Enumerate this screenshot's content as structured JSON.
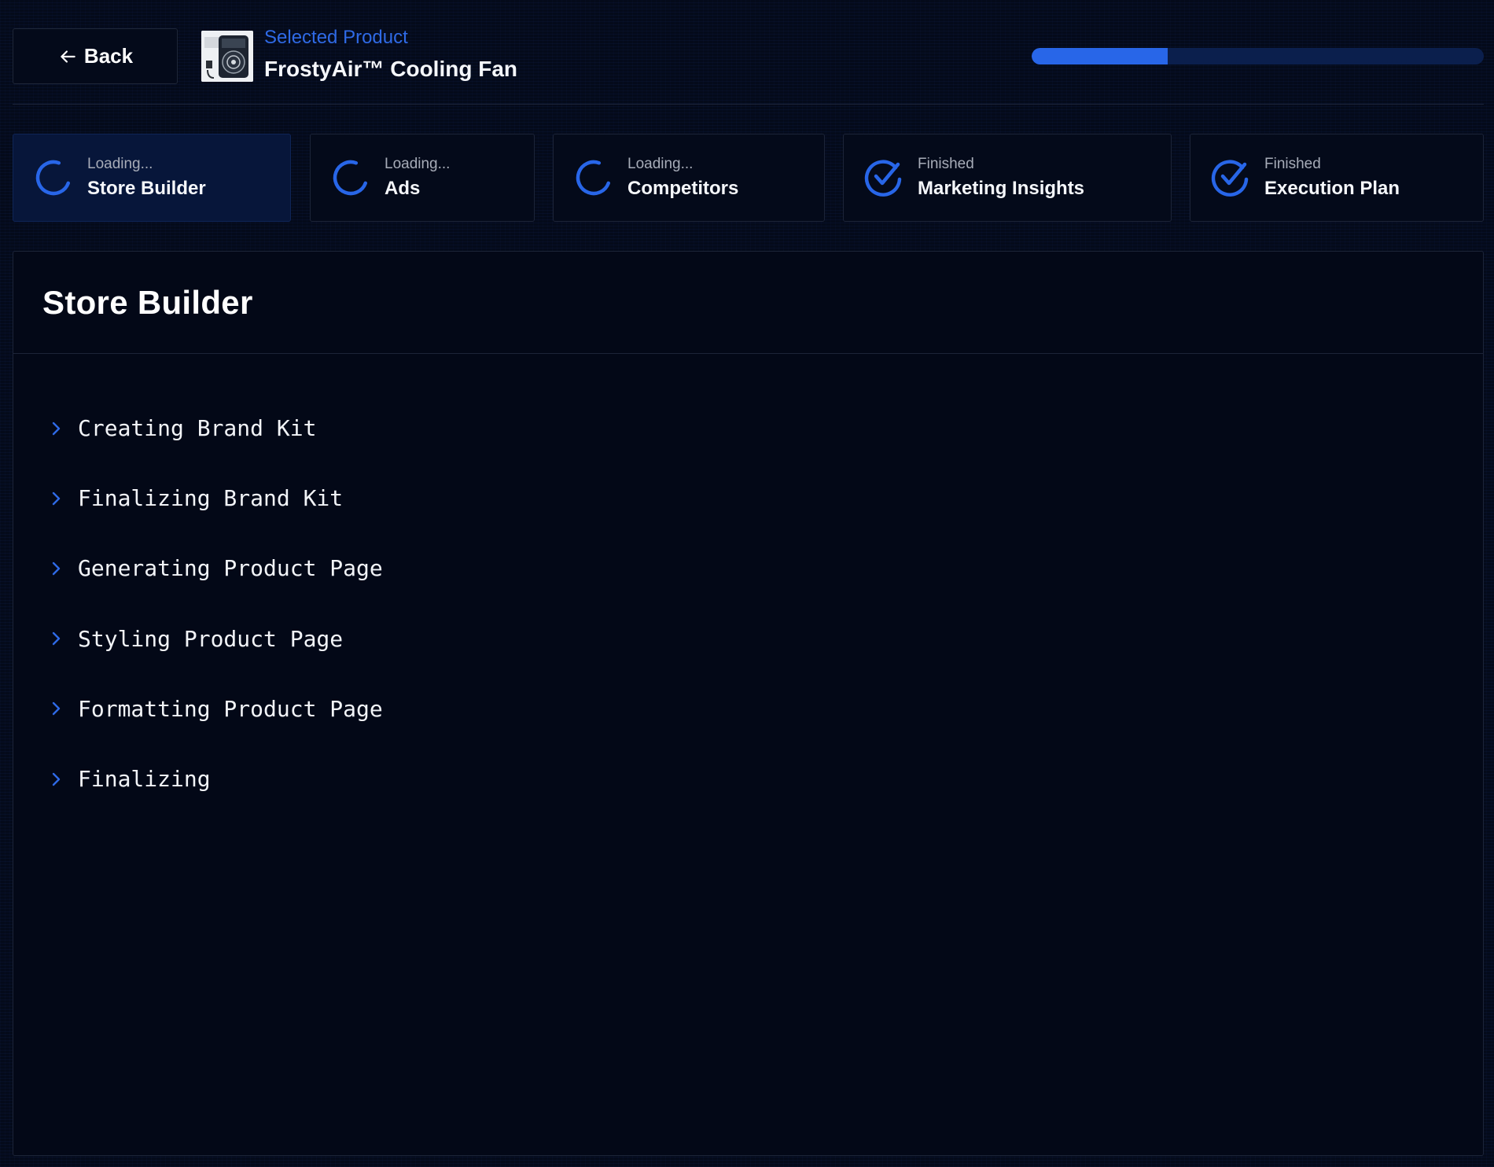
{
  "header": {
    "back_label": "Back",
    "selected_label": "Selected Product",
    "product_title": "FrostyAir™ Cooling Fan",
    "product_thumbnail": "portable-cooling-fan-image",
    "progress_percent": 30
  },
  "colors": {
    "accent": "#2866e8",
    "accent_text": "#2f6ae6",
    "progress_track": "#0b1f4d",
    "background": "#040a1a",
    "active_card": "#07163a",
    "border": "#1c2438"
  },
  "cards": [
    {
      "status": "Loading...",
      "name": "Store Builder",
      "state": "loading",
      "icon": "spinner-icon",
      "active": true
    },
    {
      "status": "Loading...",
      "name": "Ads",
      "state": "loading",
      "icon": "spinner-icon",
      "active": false
    },
    {
      "status": "Loading...",
      "name": "Competitors",
      "state": "loading",
      "icon": "spinner-icon",
      "active": false
    },
    {
      "status": "Finished",
      "name": "Marketing Insights",
      "state": "finished",
      "icon": "check-circle-icon",
      "active": false
    },
    {
      "status": "Finished",
      "name": "Execution Plan",
      "state": "finished",
      "icon": "check-circle-icon",
      "active": false
    }
  ],
  "panel": {
    "title": "Store Builder",
    "steps": [
      {
        "label": "Creating Brand Kit",
        "icon": "chevron-right-icon"
      },
      {
        "label": "Finalizing Brand Kit",
        "icon": "chevron-right-icon"
      },
      {
        "label": "Generating Product Page",
        "icon": "chevron-right-icon"
      },
      {
        "label": "Styling Product Page",
        "icon": "chevron-right-icon"
      },
      {
        "label": "Formatting Product Page",
        "icon": "chevron-right-icon"
      },
      {
        "label": "Finalizing",
        "icon": "chevron-right-icon"
      }
    ]
  }
}
